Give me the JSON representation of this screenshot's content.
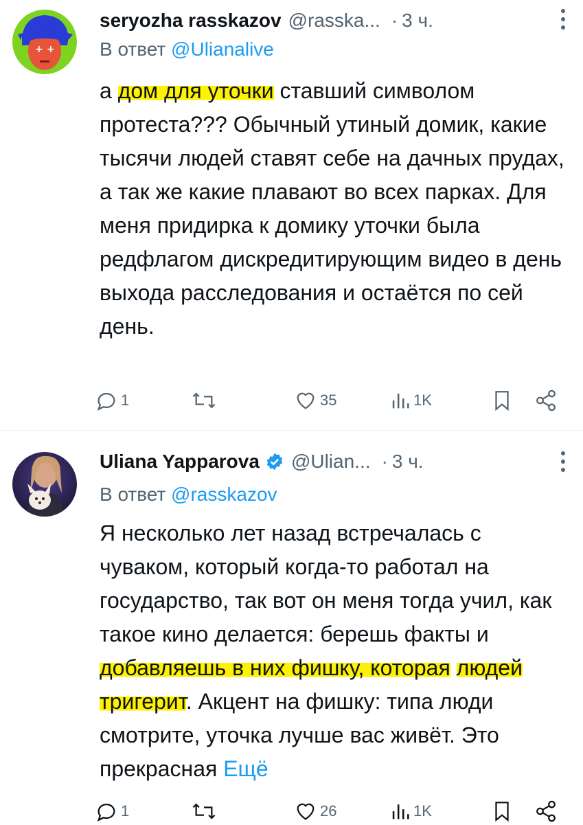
{
  "tweets": [
    {
      "display_name": "seryozha rasskazov",
      "handle": "@rasska...",
      "dot": "·",
      "time": "3 ч.",
      "reply_prefix": "В ответ",
      "reply_mention": "@Ulianalive",
      "body": {
        "before": "а ",
        "highlight1": "дом для уточки",
        "after": " ставший символом протеста??? Обычный утиный домик, какие тысячи людей ставят себе на дачных прудах, а так же какие плавают во всех парках. Для меня придирка к домику уточки была редфлагом дискредитирующим видео в день выхода расследования и остаётся по сей день."
      },
      "actions": {
        "replies": "1",
        "reposts": "",
        "likes": "35",
        "views": "1K"
      },
      "icons": [
        "reply-icon",
        "repost-icon",
        "like-icon",
        "views-icon",
        "bookmark-icon",
        "share-icon"
      ]
    },
    {
      "display_name": "Uliana Yapparova",
      "handle": "@Ulian...",
      "dot": "·",
      "time": "3 ч.",
      "verified": true,
      "reply_prefix": "В ответ",
      "reply_mention": "@rasskazov",
      "body": {
        "before": "Я несколько лет назад встречалась с чуваком, который когда-то работал на государство, так вот он меня тогда учил, как такое кино делается: берешь факты и ",
        "highlight1": "добавляешь в них фишку, которая",
        "between": " ",
        "highlight2": "людей тригерит",
        "after": ". Акцент на фишку: типа люди смотрите, уточка лучше вас живёт. Это прекрасная ",
        "more": "Ещё"
      },
      "actions": {
        "replies": "1",
        "reposts": "",
        "likes": "26",
        "views": "1K"
      },
      "icons": [
        "reply-icon",
        "repost-icon",
        "like-icon",
        "views-icon",
        "bookmark-icon",
        "share-icon"
      ]
    }
  ],
  "colors": {
    "text": "#0f1419",
    "secondary": "#536471",
    "link": "#1d9bf0",
    "highlight": "#fff200",
    "verified": "#1d9bf0"
  }
}
